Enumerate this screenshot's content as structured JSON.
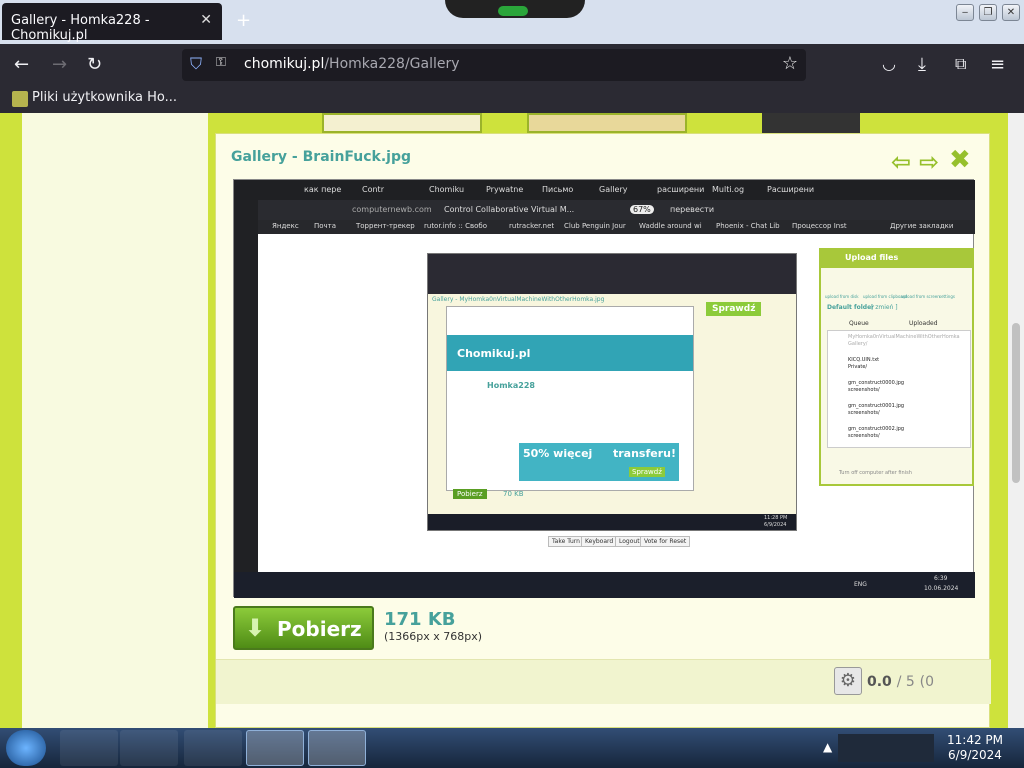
{
  "browser": {
    "tab_title": "Gallery - Homka228 - Chomikuj.pl",
    "tab_close": "✕",
    "new_tab": "+",
    "url_host": "chomikuj.pl",
    "url_path": "/Homka228/Gallery",
    "bookmark_label": "Pliki użytkownika Ho..."
  },
  "window_controls": {
    "minimize": "‒",
    "restore": "❐",
    "close": "✕"
  },
  "gallery": {
    "title": "Gallery - BrainFuck.jpg",
    "download_label": "Pobierz",
    "file_size": "171 KB",
    "dimensions": "(1366px x 768px)",
    "rating_value": "0.0",
    "rating_max": "/ 5",
    "rating_count": "(0"
  },
  "screenshot": {
    "url_host": "computernewb.com",
    "url_title": "Control Collaborative Virtual M...",
    "zoom": "67%",
    "translate": "перевести",
    "tabs": [
      "как пере",
      "Contr",
      "Chomiku",
      "Prywatne",
      "Письмо",
      "Gallery",
      "расширени",
      "Multi.og",
      "Расширени"
    ],
    "bookmarks": [
      "Яндекс",
      "Почта",
      "Торрент-трекер",
      "rutor.info :: Свобо",
      "rutracker.net",
      "Club Penguin Jour",
      "Waddle around wi",
      "Phoenix - Chat Lib",
      "Процессор Inst"
    ],
    "bookmarks_other": "Другие закладки",
    "upload_title": "Upload files",
    "upload_actions": [
      "upload from disk",
      "upload from clipboard",
      "upload from screen",
      "settings"
    ],
    "default_folder": "Default folder",
    "default_folder_change": "[ zmień ]",
    "queue_col": "Queue",
    "uploaded_col": "Uploaded",
    "upload_items": [
      {
        "name": "MyHomka0nVirtualMachineWithOtherHomka",
        "folder": "Gallery/"
      },
      {
        "name": "KICQ.UIN.txt",
        "folder": "Private/"
      },
      {
        "name": "gm_construct0000.jpg",
        "folder": "screenshots/"
      },
      {
        "name": "gm_construct0001.jpg",
        "folder": "screenshots/"
      },
      {
        "name": "gm_construct0002.jpg",
        "folder": "screenshots/"
      }
    ],
    "turn_off": "Turn off computer after finish",
    "vm_buttons": [
      "Take Turn",
      "Keyboard",
      "Logout",
      "Vote for Reset"
    ],
    "inner_title": "Gallery - MyHomka0nVirtualMachineWithOtherHomka.jpg",
    "inner_user": "Homka228",
    "inner_brand": "Chomikuj.pl",
    "inner_promo_a": "50% więcej",
    "inner_promo_b": "transferu!",
    "inner_promo_btn": "Sprawdź",
    "inner_sprawdz": "Sprawdź",
    "inner_size": "70 KB",
    "inner_download": "Pobierz",
    "inner_clock_time": "11:28 PM",
    "inner_clock_date": "6/9/2024",
    "lang": "ENG",
    "time": "6:39",
    "date": "10.06.2024"
  },
  "taskbar": {
    "time": "11:42 PM",
    "date": "6/9/2024"
  },
  "colors": {
    "accent_green": "#8ccb3a",
    "title_teal": "#46a19b",
    "page_lime": "#cde139",
    "browser_dark": "#2b2a33"
  },
  "icons": [
    "back-arrow-icon",
    "forward-arrow-icon",
    "reload-icon",
    "shield-icon",
    "lock-icon",
    "star-icon",
    "pocket-icon",
    "download-icon",
    "extensions-icon",
    "menu-icon",
    "prev-arrow-icon",
    "next-arrow-icon",
    "close-x-icon",
    "download-arrow-icon",
    "gear-icon",
    "start-orb-icon",
    "firefox-icon"
  ]
}
